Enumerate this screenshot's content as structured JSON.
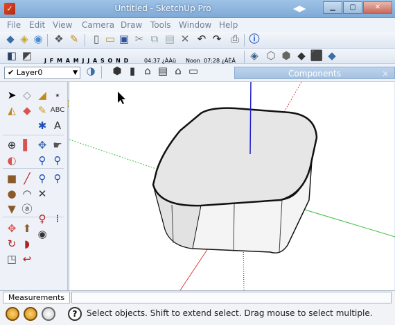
{
  "window": {
    "title": "Untitled - SketchUp Pro",
    "icon": "sketchup-logo-icon",
    "controls": [
      "minimize-icon",
      "maximize-icon",
      "close-icon"
    ]
  },
  "menubar": {
    "items": [
      "File",
      "Edit",
      "View",
      "Camera",
      "Draw",
      "Tools",
      "Window",
      "Help"
    ]
  },
  "shadows": {
    "months": "J F M A M J J A S O N D",
    "time_start": "04:37 ¿ÀÀü",
    "noon": "Noon",
    "time_end": "07:28 ¿ÀÈÄ"
  },
  "layers": {
    "current": "Layer0"
  },
  "components_panel": {
    "title": "Components",
    "close": "×"
  },
  "statusbar": {
    "measurements_label": "Measurements",
    "measurements_value": "",
    "hint": "Select objects. Shift to extend select. Drag mouse to select multiple."
  },
  "colors": {
    "axis_red": "#d94040",
    "axis_green": "#3fbf3f",
    "axis_blue": "#2020c8",
    "viewport_bg": "#ffffff",
    "titlebar": "#8fb6e0"
  }
}
